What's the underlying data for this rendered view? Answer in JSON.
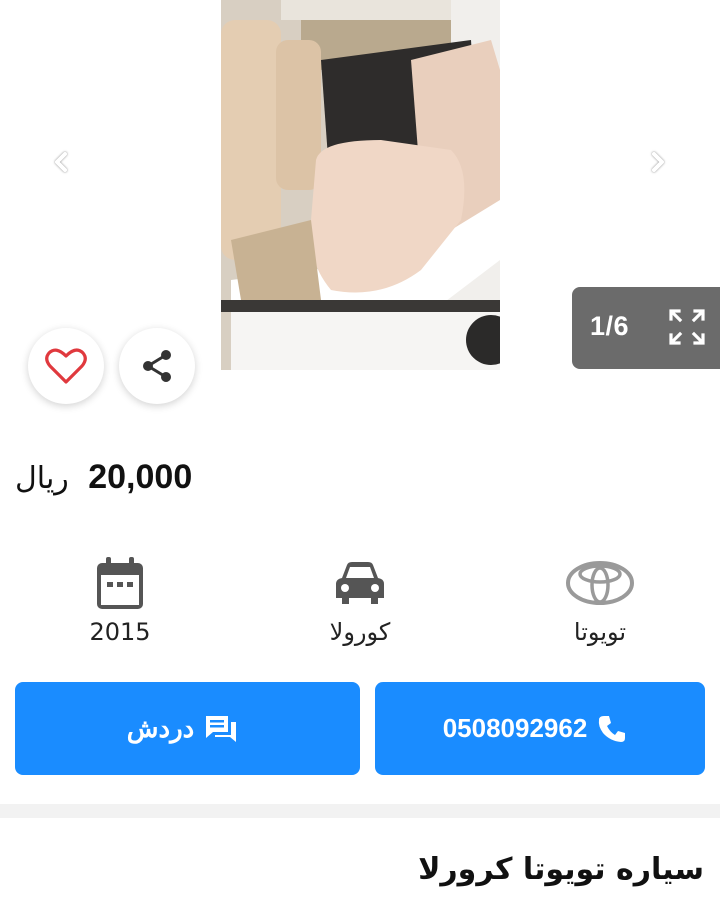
{
  "gallery": {
    "image_alt": "car rear seats",
    "counter": "1/6",
    "icons": {
      "prev": "chevron-left-icon",
      "next": "chevron-right-icon",
      "fullscreen": "fullscreen-icon"
    }
  },
  "actions": {
    "favorite_icon": "heart-icon",
    "share_icon": "share-icon"
  },
  "listing": {
    "price_value": "20,000",
    "price_currency": "ريال",
    "specs": [
      {
        "icon": "calendar-icon",
        "label": "2015"
      },
      {
        "icon": "car-icon",
        "label": "كورولا"
      },
      {
        "icon": "toyota-logo-icon",
        "label": "تويوتا"
      }
    ],
    "title": "سياره تويوتا كرورلا"
  },
  "buttons": {
    "chat_label": "دردش",
    "phone_label": "0508092962"
  },
  "colors": {
    "accent": "#1a8cff",
    "heart": "#e0393e",
    "counter_bg": "#6b6b6b"
  }
}
